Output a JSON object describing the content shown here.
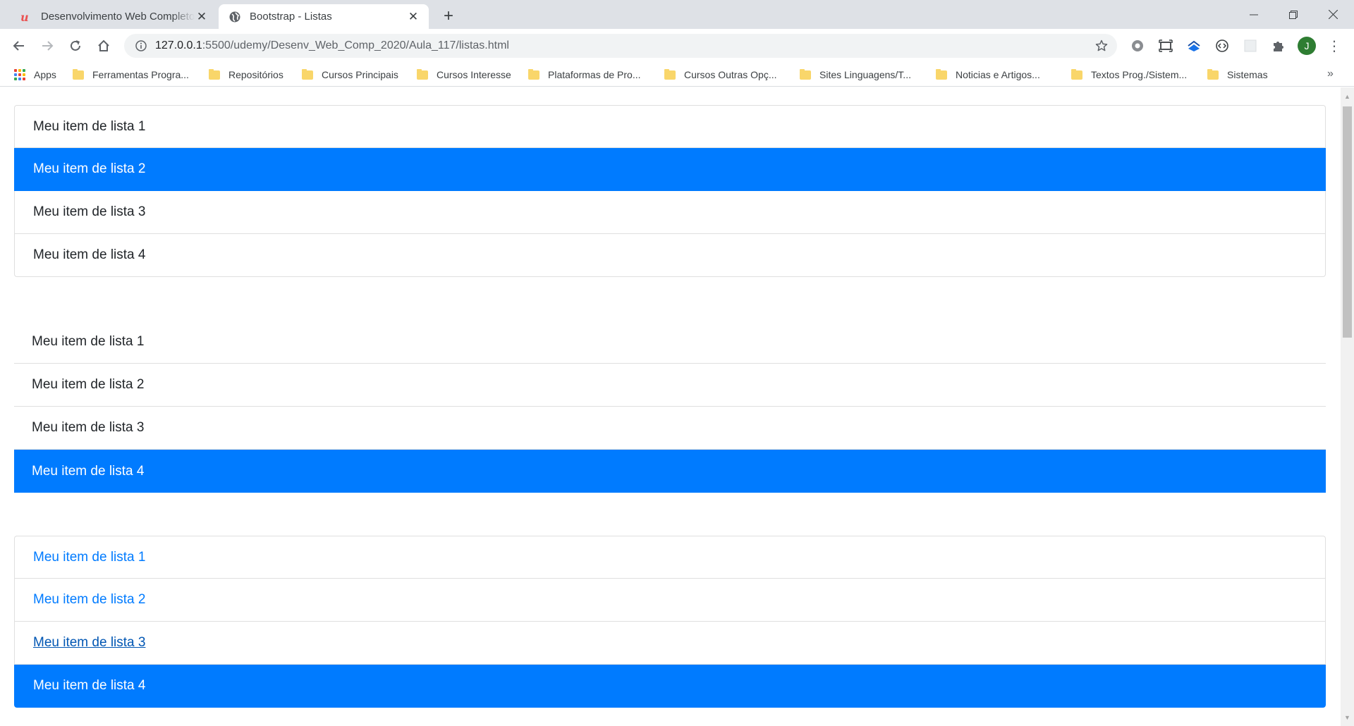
{
  "browser": {
    "tabs": [
      {
        "title": "Desenvolvimento Web Completo",
        "favicon": "udemy-icon",
        "active": false
      },
      {
        "title": "Bootstrap - Listas",
        "favicon": "globe-icon",
        "active": true
      }
    ],
    "url_host": "127.0.0.1",
    "url_path": ":5500/udemy/Desenv_Web_Comp_2020/Aula_117/listas.html",
    "profile_initial": "J",
    "bookmarks": [
      "Apps",
      "Ferramentas Progra...",
      "Repositórios",
      "Cursos Principais",
      "Cursos Interesse",
      "Plataformas de Pro...",
      "Cursos Outras Opç...",
      "Sites Linguagens/T...",
      "Noticias e Artigos...",
      "Textos Prog./Sistem...",
      "Sistemas"
    ]
  },
  "lists": {
    "bordered": {
      "items": [
        "Meu item de lista 1",
        "Meu item de lista 2",
        "Meu item de lista 3",
        "Meu item de lista 4"
      ],
      "active_index": 1
    },
    "flush": {
      "items": [
        "Meu item de lista 1",
        "Meu item de lista 2",
        "Meu item de lista 3",
        "Meu item de lista 4"
      ],
      "active_index": 3
    },
    "links": {
      "items": [
        "Meu item de lista 1",
        "Meu item de lista 2",
        "Meu item de lista 3",
        "Meu item de lista 4"
      ],
      "active_index": 3,
      "hover_index": 2
    }
  },
  "colors": {
    "active_bg": "#007bff",
    "link": "#007bff",
    "link_hover": "#0056b3",
    "tab_strip": "#dee1e6"
  }
}
